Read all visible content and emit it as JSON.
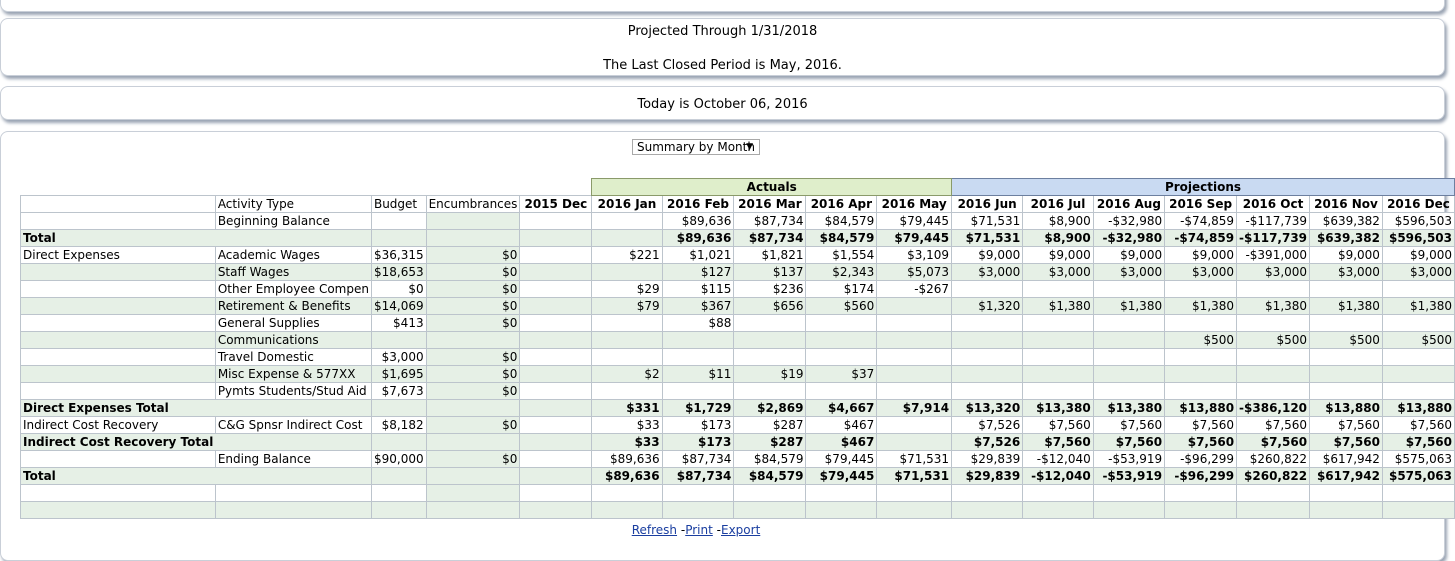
{
  "header": {
    "projected_through": "Projected Through 1/31/2018",
    "last_closed": "The Last Closed Period is May, 2016.",
    "today": "Today is October 06, 2016"
  },
  "view_select": {
    "value": "Summary by Month",
    "arrow": "▼"
  },
  "groups": {
    "actuals": "Actuals",
    "projections": "Projections"
  },
  "columns": {
    "activity_type": "Activity Type",
    "budget": "Budget",
    "encumbrances": "Encumbrances",
    "months": [
      "2015 Dec",
      "2016 Jan",
      "2016 Feb",
      "2016 Mar",
      "2016 Apr",
      "2016 May",
      "2016 Jun",
      "2016 Jul",
      "2016 Aug",
      "2016 Sep",
      "2016 Oct",
      "2016 Nov",
      "2016 Dec"
    ]
  },
  "rows": [
    {
      "cat": "",
      "label": "Beginning Balance",
      "budget": "",
      "enc": "",
      "v": [
        "",
        "",
        "$89,636",
        "$87,734",
        "$84,579",
        "$79,445",
        "$71,531",
        "$8,900",
        "-$32,980",
        "-$74,859",
        "-$117,739",
        "$639,382",
        "$596,503"
      ]
    },
    {
      "cat": "Total",
      "label": "",
      "budget": "",
      "enc": "",
      "v": [
        "",
        "",
        "$89,636",
        "$87,734",
        "$84,579",
        "$79,445",
        "$71,531",
        "$8,900",
        "-$32,980",
        "-$74,859",
        "-$117,739",
        "$639,382",
        "$596,503"
      ]
    },
    {
      "cat": "Direct Expenses",
      "label": "Academic Wages",
      "budget": "$36,315",
      "enc": "$0",
      "v": [
        "",
        "$221",
        "$1,021",
        "$1,821",
        "$1,554",
        "$3,109",
        "$9,000",
        "$9,000",
        "$9,000",
        "$9,000",
        "-$391,000",
        "$9,000",
        "$9,000"
      ]
    },
    {
      "cat": "",
      "label": "Staff Wages",
      "budget": "$18,653",
      "enc": "$0",
      "v": [
        "",
        "",
        "$127",
        "$137",
        "$2,343",
        "$5,073",
        "$3,000",
        "$3,000",
        "$3,000",
        "$3,000",
        "$3,000",
        "$3,000",
        "$3,000"
      ]
    },
    {
      "cat": "",
      "label": "Other Employee Compen",
      "budget": "$0",
      "enc": "$0",
      "v": [
        "",
        "$29",
        "$115",
        "$236",
        "$174",
        "-$267",
        "",
        "",
        "",
        "",
        "",
        "",
        ""
      ]
    },
    {
      "cat": "",
      "label": "Retirement & Benefits",
      "budget": "$14,069",
      "enc": "$0",
      "v": [
        "",
        "$79",
        "$367",
        "$656",
        "$560",
        "",
        "$1,320",
        "$1,380",
        "$1,380",
        "$1,380",
        "$1,380",
        "$1,380",
        "$1,380"
      ]
    },
    {
      "cat": "",
      "label": "General Supplies",
      "budget": "$413",
      "enc": "$0",
      "v": [
        "",
        "",
        "$88",
        "",
        "",
        "",
        "",
        "",
        "",
        "",
        "",
        "",
        ""
      ]
    },
    {
      "cat": "",
      "label": "Communications",
      "budget": "",
      "enc": "",
      "v": [
        "",
        "",
        "",
        "",
        "",
        "",
        "",
        "",
        "",
        "$500",
        "$500",
        "$500",
        "$500"
      ]
    },
    {
      "cat": "",
      "label": "Travel Domestic",
      "budget": "$3,000",
      "enc": "$0",
      "v": [
        "",
        "",
        "",
        "",
        "",
        "",
        "",
        "",
        "",
        "",
        "",
        "",
        ""
      ]
    },
    {
      "cat": "",
      "label": "Misc Expense & 577XX",
      "budget": "$1,695",
      "enc": "$0",
      "v": [
        "",
        "$2",
        "$11",
        "$19",
        "$37",
        "",
        "",
        "",
        "",
        "",
        "",
        "",
        ""
      ]
    },
    {
      "cat": "",
      "label": "Pymts Students/Stud Aid",
      "budget": "$7,673",
      "enc": "$0",
      "v": [
        "",
        "",
        "",
        "",
        "",
        "",
        "",
        "",
        "",
        "",
        "",
        "",
        ""
      ]
    },
    {
      "cat": "Direct Expenses Total",
      "label": "",
      "budget": "",
      "enc": "",
      "v": [
        "",
        "$331",
        "$1,729",
        "$2,869",
        "$4,667",
        "$7,914",
        "$13,320",
        "$13,380",
        "$13,380",
        "$13,880",
        "-$386,120",
        "$13,880",
        "$13,880"
      ]
    },
    {
      "cat": "Indirect Cost Recovery",
      "label": "C&G Spnsr Indirect Cost",
      "budget": "$8,182",
      "enc": "$0",
      "v": [
        "",
        "$33",
        "$173",
        "$287",
        "$467",
        "",
        "$7,526",
        "$7,560",
        "$7,560",
        "$7,560",
        "$7,560",
        "$7,560",
        "$7,560"
      ]
    },
    {
      "cat": "Indirect Cost Recovery Total",
      "label": "",
      "budget": "",
      "enc": "",
      "v": [
        "",
        "$33",
        "$173",
        "$287",
        "$467",
        "",
        "$7,526",
        "$7,560",
        "$7,560",
        "$7,560",
        "$7,560",
        "$7,560",
        "$7,560"
      ]
    },
    {
      "cat": "",
      "label": "Ending Balance",
      "budget": "$90,000",
      "enc": "$0",
      "v": [
        "",
        "$89,636",
        "$87,734",
        "$84,579",
        "$79,445",
        "$71,531",
        "$29,839",
        "-$12,040",
        "-$53,919",
        "-$96,299",
        "$260,822",
        "$617,942",
        "$575,063"
      ]
    },
    {
      "cat": "Total",
      "label": "",
      "budget": "",
      "enc": "",
      "v": [
        "",
        "$89,636",
        "$87,734",
        "$84,579",
        "$79,445",
        "$71,531",
        "$29,839",
        "-$12,040",
        "-$53,919",
        "-$96,299",
        "$260,822",
        "$617,942",
        "$575,063"
      ]
    },
    {
      "cat": "",
      "label": "",
      "budget": "",
      "enc": "",
      "v": [
        "",
        "",
        "",
        "",
        "",
        "",
        "",
        "",
        "",
        "",
        "",
        "",
        ""
      ]
    },
    {
      "cat": "",
      "label": "",
      "budget": "",
      "enc": "",
      "v": [
        "",
        "",
        "",
        "",
        "",
        "",
        "",
        "",
        "",
        "",
        "",
        "",
        ""
      ]
    }
  ],
  "links": {
    "refresh": "Refresh",
    "print": "Print",
    "export": "Export",
    "sep": "-"
  }
}
